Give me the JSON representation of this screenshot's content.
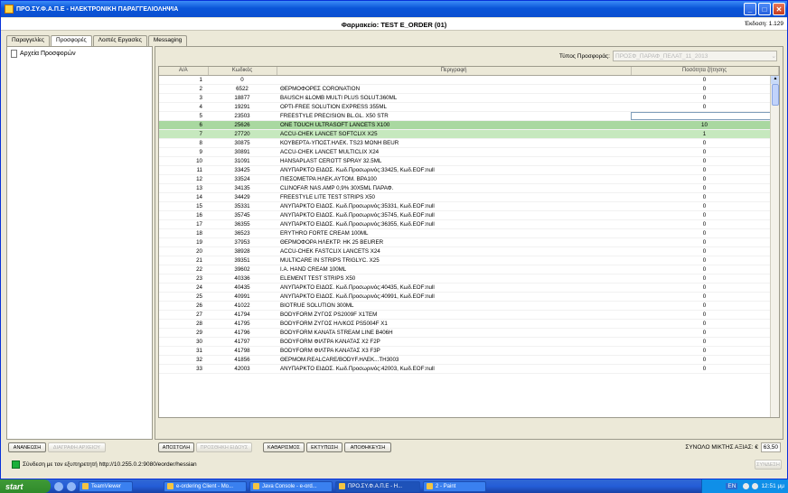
{
  "window": {
    "title": "ΠΡΟ.ΣΥ.Φ.Α.Π.Ε - ΗΛΕΚΤΡΟΝΙΚΗ ΠΑΡΑΓΓΕΛΙΟΛΗΨΙΑ",
    "minimize": "_",
    "maximize": "□",
    "close": "✕"
  },
  "header": {
    "pharmacy": "Φαρμακείο: TEST E_ORDER (01)",
    "version": "Έκδοση: 1.129"
  },
  "tabs": [
    "Παραγγελίες",
    "Προσφορές",
    "Λοιπές Εργασίες",
    "Messaging"
  ],
  "left": {
    "tree_item": "Αρχεία Προσφορών"
  },
  "offer_type": {
    "label": "Τύπος Προσφοράς:",
    "value": "ΠΡΟΣΦ_ΠΑΡΑΦ_ΠΕΛΑΤ_11_2013",
    "arrow": "⌄"
  },
  "table": {
    "headers": {
      "aa": "Α/Α",
      "code": "Κωδικός",
      "desc": "Περιγραφή",
      "qty": "Ποσότητα ζήτησης"
    },
    "rows": [
      {
        "aa": "1",
        "code": "0",
        "desc": "",
        "qty": "0"
      },
      {
        "aa": "2",
        "code": "6522",
        "desc": "ΘΕΡΜΟΦΟΡΕΣ CORONATION",
        "qty": "0"
      },
      {
        "aa": "3",
        "code": "18877",
        "desc": "BAUSCH &LOMB MULTI PLUS SOLUT.360ML",
        "qty": "0"
      },
      {
        "aa": "4",
        "code": "19291",
        "desc": "OPTI-FREE SOLUTION EXPRESS 355ML",
        "qty": "0"
      },
      {
        "aa": "5",
        "code": "23503",
        "desc": "FREESTYLE PRECISION BL.GL. X50 STR",
        "qty": ""
      },
      {
        "aa": "6",
        "code": "25626",
        "desc": "ONE TOUCH ULTRASOFT LANCETS X100",
        "qty": "10"
      },
      {
        "aa": "7",
        "code": "27720",
        "desc": "ACCU-CHEK LANCET SOFTCLIX X25",
        "qty": "1"
      },
      {
        "aa": "8",
        "code": "30875",
        "desc": "ΚΟΥΒΕΡΤΑ-ΥΠΟΣΤ.ΗΛΕΚ. TS23 MONH BEUR",
        "qty": "0"
      },
      {
        "aa": "9",
        "code": "30891",
        "desc": "ACCU-CHEK LANCET MULTICLIX X24",
        "qty": "0"
      },
      {
        "aa": "10",
        "code": "31091",
        "desc": "HANSAPLAST CEROTT SPRAY 32.5ML",
        "qty": "0"
      },
      {
        "aa": "11",
        "code": "33425",
        "desc": "ΑΝΥΠΑΡΚΤΟ ΕΙΔΟΣ. Κωδ.Προσωρινός:33425, Κωδ.EOF:null",
        "qty": "0"
      },
      {
        "aa": "12",
        "code": "33524",
        "desc": "ΠΙΕΣΟΜΕΤΡΑ ΗΛΕΚ.ΑΥΤΟΜ. BPA100",
        "qty": "0"
      },
      {
        "aa": "13",
        "code": "34135",
        "desc": "CLINOFAR NAS.AMP 0,9% 30X5ML ΠΑΡΑΦ.",
        "qty": "0"
      },
      {
        "aa": "14",
        "code": "34429",
        "desc": "FREESTYLE LITE TEST STRIPS X50",
        "qty": "0"
      },
      {
        "aa": "15",
        "code": "35331",
        "desc": "ΑΝΥΠΑΡΚΤΟ ΕΙΔΟΣ. Κωδ.Προσωρινός:35331, Κωδ.EOF:null",
        "qty": "0"
      },
      {
        "aa": "16",
        "code": "35745",
        "desc": "ΑΝΥΠΑΡΚΤΟ ΕΙΔΟΣ. Κωδ.Προσωρινός:35745, Κωδ.EOF:null",
        "qty": "0"
      },
      {
        "aa": "17",
        "code": "36355",
        "desc": "ΑΝΥΠΑΡΚΤΟ ΕΙΔΟΣ. Κωδ.Προσωρινός:36355, Κωδ.EOF:null",
        "qty": "0"
      },
      {
        "aa": "18",
        "code": "36523",
        "desc": "ERYTHRO FORTE CREAM 100ML",
        "qty": "0"
      },
      {
        "aa": "19",
        "code": "37953",
        "desc": "ΘΕΡΜΟΦΟΡΑ ΗΛΕΚΤΡ. HK 25 BEURER",
        "qty": "0"
      },
      {
        "aa": "20",
        "code": "38928",
        "desc": "ACCU-CHEK FASTCLIX LANCETS X24",
        "qty": "0"
      },
      {
        "aa": "21",
        "code": "39351",
        "desc": "MULTICARE IN STRIPS TRIGLYC. X25",
        "qty": "0"
      },
      {
        "aa": "22",
        "code": "39602",
        "desc": "I.A. HAND CREAM 100ML",
        "qty": "0"
      },
      {
        "aa": "23",
        "code": "40336",
        "desc": "ELEMENT TEST STRIPS X50",
        "qty": "0"
      },
      {
        "aa": "24",
        "code": "40435",
        "desc": "ΑΝΥΠΑΡΚΤΟ ΕΙΔΟΣ. Κωδ.Προσωρινός:40435, Κωδ.EOF:null",
        "qty": "0"
      },
      {
        "aa": "25",
        "code": "40991",
        "desc": "ΑΝΥΠΑΡΚΤΟ ΕΙΔΟΣ. Κωδ.Προσωρινός:40991, Κωδ.EOF:null",
        "qty": "0"
      },
      {
        "aa": "26",
        "code": "41022",
        "desc": "BIOTRUE SOLUTION 300ML",
        "qty": "0"
      },
      {
        "aa": "27",
        "code": "41794",
        "desc": "BODYFORM ΖΥΓΟΣ PS2009F X1TEM",
        "qty": "0"
      },
      {
        "aa": "28",
        "code": "41795",
        "desc": "BODYFORM ΖΥΓΟΣ ΗΛ/ΚΟΣ PS5004F X1",
        "qty": "0"
      },
      {
        "aa": "29",
        "code": "41796",
        "desc": "BODYFORM ΚΑΝΑΤΑ STREAM LINE B406H",
        "qty": "0"
      },
      {
        "aa": "30",
        "code": "41797",
        "desc": "BODYFORM ΦΙΛΤΡΑ ΚΑΝΑΤΑΣ X2 F2P",
        "qty": "0"
      },
      {
        "aa": "31",
        "code": "41798",
        "desc": "BODYFORM ΦΙΛΤΡΑ ΚΑΝΑΤΑΣ X3 F3P",
        "qty": "0"
      },
      {
        "aa": "32",
        "code": "41856",
        "desc": "ΘΕΡΜΟΜ.REALCARE/BODYF.ΗΛΕΚ...TH3003",
        "qty": "0"
      },
      {
        "aa": "33",
        "code": "42003",
        "desc": "ΑΝΥΠΑΡΚΤΟ ΕΙΔΟΣ. Κωδ.Προσωρινός:42003, Κωδ.EOF:null",
        "qty": "0"
      }
    ]
  },
  "footer": {
    "refresh": "ΑΝΑΝΕΩΣΗ",
    "delete_file": "ΔΙΑΓΡΑΦΗ ΑΡΧΕΙΟΥ",
    "send": "ΑΠΟΣΤΟΛΗ",
    "add_item": "ΠΡΟΣΘΗΚΗ ΕΙΔΟΥΣ",
    "clear": "ΚΑΘΑΡΙΣΜΟΣ",
    "print": "ΕΚΤΥΠΩΣΗ",
    "save": "ΑΠΟΘΗΚΕΥΣΗ",
    "total_label": "ΣΥΝΟΛΟ ΜΙΚΤΗΣ ΑΞΙΑΣ: €",
    "total_value": "63,50"
  },
  "status": {
    "text": "Σύνδεση με τον εξυπηρετητή http://10.255.0.2:9080/eorder/hessian",
    "connect": "ΣΥΝΔΕΣΗ"
  },
  "taskbar": {
    "start": "start",
    "tasks": [
      "TeamViewer",
      "e-ordering Client - Mo...",
      "Java Console - e-ord...",
      "ΠΡΟ.ΣΥ.Φ.Α.Π.Ε - Η...",
      "2 - Paint"
    ],
    "lang": "EN",
    "clock": "12:51 μμ"
  }
}
